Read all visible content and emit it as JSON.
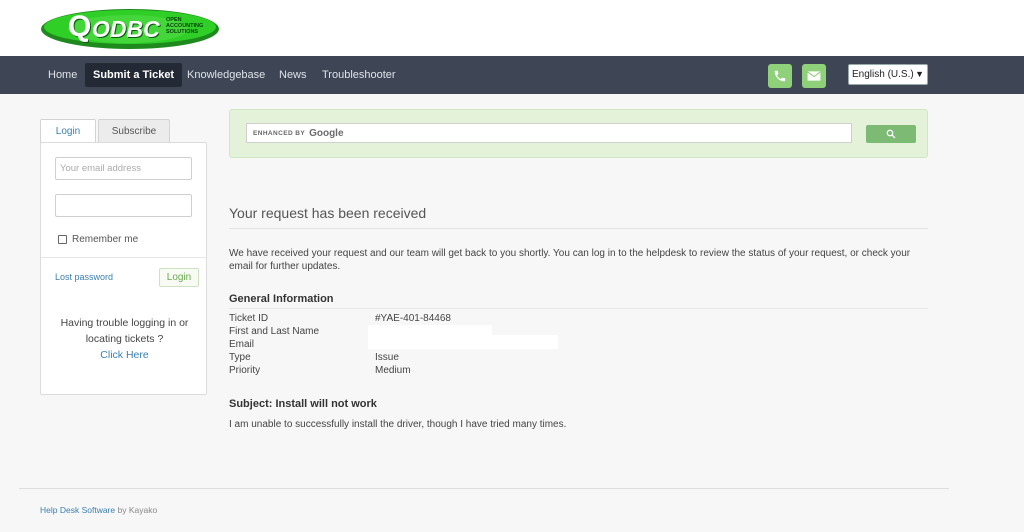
{
  "brand": {
    "logo_text": "ODBC",
    "logo_letter": "Q",
    "logo_tagline_1": "OPEN",
    "logo_tagline_2": "ACCOUNTING",
    "logo_tagline_3": "SOLUTIONS"
  },
  "nav": {
    "items": [
      {
        "label": "Home"
      },
      {
        "label": "Submit a Ticket"
      },
      {
        "label": "Knowledgebase"
      },
      {
        "label": "News"
      },
      {
        "label": "Troubleshooter"
      }
    ],
    "active": "Submit a Ticket",
    "contact_icons": [
      "phone-icon",
      "mail-icon"
    ],
    "language": "English (U.S.)"
  },
  "sidebar": {
    "tabs": [
      {
        "label": "Login"
      },
      {
        "label": "Subscribe"
      }
    ],
    "email_placeholder": "Your email address",
    "remember_label": "Remember me",
    "lost_password": "Lost password",
    "login_button": "Login",
    "trouble_text": "Having trouble logging in or locating tickets ?",
    "click_here": "Click Here"
  },
  "search": {
    "enhanced_by": "ENHANCED BY",
    "google": "Google",
    "icon": "search-icon"
  },
  "main": {
    "title": "Your request has been received",
    "message": "We have received your request and our team will get back to you shortly. You can log in to the helpdesk to review the status of your request, or check your email for further updates.",
    "general_info_title": "General Information",
    "info": [
      {
        "label": "Ticket ID",
        "value": "#YAE-401-84468"
      },
      {
        "label": "First and Last Name",
        "value": ""
      },
      {
        "label": "Email",
        "value": ""
      },
      {
        "label": "Type",
        "value": "Issue"
      },
      {
        "label": "Priority",
        "value": "Medium"
      }
    ],
    "subject_title": "Subject: Install will not work",
    "subject_text": "I am unable to successfully install the driver, though I have tried many times."
  },
  "footer": {
    "link": "Help Desk Software",
    "suffix": " by Kayako"
  },
  "colors": {
    "navbar": "#3e4655",
    "accent_green": "#8fd17a",
    "link_blue": "#3a7fb0"
  }
}
